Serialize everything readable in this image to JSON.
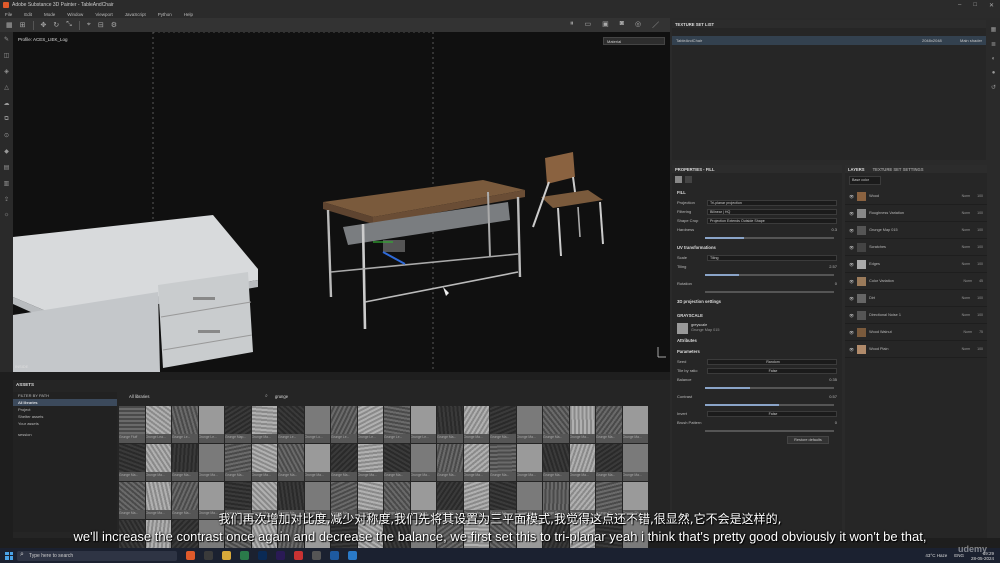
{
  "app": {
    "title": "Adobe Substance 3D Painter - TableAndChair",
    "window_controls": [
      "–",
      "□",
      "✕"
    ]
  },
  "menu": [
    "File",
    "Edit",
    "Mode",
    "Window",
    "Viewport",
    "JavaScript",
    "Python",
    "Help"
  ],
  "viewport": {
    "profile": "Profile: ACES_LIEK_Log",
    "channel": "Material",
    "mode": "INSIDE"
  },
  "assets": {
    "title": "ASSETS",
    "filter_label": "FILTER BY PATH",
    "tree": [
      "All libraries",
      "Project",
      "Shelter assets",
      "Your assets",
      "session"
    ],
    "path_label": "All libraries",
    "search_value": "grunge",
    "tiles": [
      "Grunge Fluff",
      "Grunge Lea...",
      "Grunge Le...",
      "Grunge Le...",
      "Grunge Map...",
      "Grunge Ma...",
      "Grunge Le...",
      "Grunge Lo...",
      "Grunge Le...",
      "Grunge Le...",
      "Grunge Le...",
      "Grunge Le...",
      "Grunge Ma...",
      "Grunge Ma...",
      "Grunge Ma...",
      "Grunge Ma...",
      "Grunge Ma...",
      "Grunge Ma...",
      "Grunge Ma...",
      "Grunge Ma...",
      "Grunge Ma...",
      "Grunge Ma...",
      "Grunge Ma...",
      "Grunge Ma...",
      "Grunge Ma...",
      "Grunge Ma...",
      "Grunge Ma...",
      "Grunge Ma...",
      "Grunge Ma...",
      "Grunge Ma...",
      "Grunge Ma...",
      "Grunge Ma...",
      "Grunge Ma...",
      "Grunge Ma...",
      "Grunge Ma...",
      "Grunge Ma...",
      "Grunge Ma...",
      "Grunge Ma...",
      "Grunge Ma...",
      "Grunge Ma...",
      "Grunge Ma...",
      "Grunge Ma...",
      "Grunge Ma...",
      "Grunge Ma...",
      "Grunge Ma...",
      "Grunge Ma...",
      "Grunge Ma...",
      "Grunge Ma...",
      "Grunge Ma...",
      "Grunge Ma...",
      "Grunge Ma...",
      "Grunge Ma...",
      "Grunge Ma...",
      "Grunge Ma...",
      "Grunge Ma...",
      "Grunge Ma...",
      "Grunge Sc...",
      "Grunge Sc...",
      "Grunge Sc...",
      "Grunge Sh...",
      "",
      "",
      "",
      "",
      "",
      "",
      "",
      "",
      "",
      "",
      "",
      "",
      "",
      "",
      "",
      "",
      "",
      "",
      "",
      ""
    ]
  },
  "texture_set_list": {
    "title": "TEXTURE SET LIST",
    "item": "TableAndChair",
    "resolution": "2048x2048",
    "shader": "Main shader"
  },
  "properties": {
    "title": "PROPERTIES - FILL",
    "fill_label": "FILL",
    "projection_label": "Projection",
    "projection_value": "Tri-planar projection",
    "filtering_label": "Filtering",
    "filtering_value": "Bilinear | HQ",
    "shape_crop_label": "Shape Crop",
    "shape_crop_value": "Projection Extends Outside Shape",
    "hardness_label": "Hardness",
    "hardness_value": "0.3",
    "uv_label": "UV transformations",
    "scale_label": "Scale",
    "scale_value": "Tiling",
    "tiling_label": "Tiling",
    "tiling_value": "2.57",
    "rotation_label": "Rotation",
    "rotation_value": "0",
    "proj3d_label": "3D projection settings",
    "grayscale_label": "GRAYSCALE",
    "gs_name": "greyscale",
    "gs_sub": "Grunge Map 015",
    "attributes_label": "Attributes",
    "parameters_label": "Parameters",
    "seed_label": "Seed",
    "seed_value": "Random",
    "tile_ratio_label": "Tile by ratio",
    "tile_ratio_value": "False",
    "balance_label": "Balance",
    "balance_value": "0.35",
    "contrast_label": "Contrast",
    "contrast_value": "0.57",
    "invert_label": "Invert",
    "invert_value": "False",
    "brush_label": "Brush Pattern",
    "brush_value": "0",
    "restore_label": "Restore defaults",
    "levels": {
      "hardness": 0.3,
      "tiling": 0.26,
      "rotation": 0.0,
      "balance": 0.35,
      "contrast": 0.57,
      "brush": 0.0
    }
  },
  "layers": {
    "tab1": "LAYERS",
    "tab2": "TEXTURE SET SETTINGS",
    "channel": "Base color",
    "items": [
      {
        "name": "Wood",
        "blend": "Norm",
        "opacity": "100"
      },
      {
        "name": "Roughness Variation",
        "blend": "Norm",
        "opacity": "100"
      },
      {
        "name": "Grunge Map 015",
        "blend": "Norm",
        "opacity": "100"
      },
      {
        "name": "Scratches",
        "blend": "Norm",
        "opacity": "100"
      },
      {
        "name": "Edges",
        "blend": "Norm",
        "opacity": "100"
      },
      {
        "name": "Color Variation",
        "blend": "Norm",
        "opacity": "45"
      },
      {
        "name": "Dirt",
        "blend": "Norm",
        "opacity": "100"
      },
      {
        "name": "Directional Noise 1",
        "blend": "Norm",
        "opacity": "100"
      },
      {
        "name": "Wood Walnut",
        "blend": "Norm",
        "opacity": "75"
      },
      {
        "name": "Wood Plain",
        "blend": "Norm",
        "opacity": "100"
      }
    ]
  },
  "subtitles": {
    "cn": "我们再次增加对比度,减少对称度,我们先将其设置为三平面模式,我觉得这点还不错,很显然,它不会是这样的,",
    "en": "we'll increase the contrast once again and decrease the balance, we first set this to tri-planar yeah i think that's pretty good obviously it won't be that,"
  },
  "taskbar": {
    "search_placeholder": "Type here to search",
    "weather": "43°C Haze",
    "lang": "ENG",
    "time": "19:29",
    "date": "28-05-2024"
  },
  "watermark": "udemy",
  "colors": {
    "accent": "#4aa3e8",
    "brand": "#e05a2b"
  }
}
